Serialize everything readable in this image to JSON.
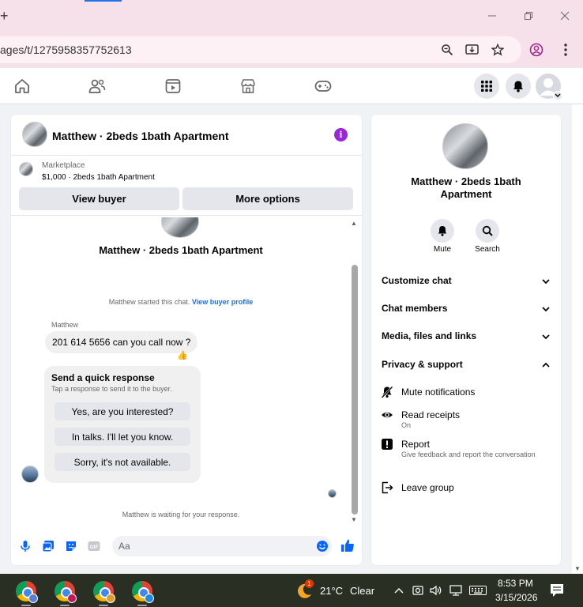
{
  "browser": {
    "url": "ages/t/1275958357752613",
    "new_tab_label": "+"
  },
  "header": {
    "title": "Matthew · 2beds 1bath Apartment"
  },
  "marketplace": {
    "label": "Marketplace",
    "price_line": "$1,000 · 2beds 1bath Apartment",
    "view_buyer": "View buyer",
    "more_options": "More options"
  },
  "conversation": {
    "title": "Matthew · 2beds 1bath Apartment",
    "started_text": "Matthew started this chat.",
    "view_profile": "View buyer profile",
    "sender": "Matthew",
    "message": "201 614 5656 can you call now ?",
    "reaction": "👍",
    "quick_title": "Send a quick response",
    "quick_subtitle": "Tap a response to send it to the buyer.",
    "quick_options": [
      "Yes, are you interested?",
      "In talks. I'll let you know.",
      "Sorry, it's not available."
    ],
    "waiting": "Matthew is waiting for your response."
  },
  "composer": {
    "placeholder": "Aa"
  },
  "info": {
    "title": "Matthew · 2beds 1bath Apartment",
    "mute": "Mute",
    "search": "Search",
    "sections": [
      "Customize chat",
      "Chat members",
      "Media, files and links",
      "Privacy & support"
    ],
    "privacy_items": [
      {
        "title": "Mute notifications",
        "sub": ""
      },
      {
        "title": "Read receipts",
        "sub": "On"
      },
      {
        "title": "Report",
        "sub": "Give feedback and report the conversation"
      },
      {
        "title": "Leave group",
        "sub": ""
      }
    ]
  },
  "taskbar": {
    "weather_temp": "21°C",
    "weather_text": "Clear",
    "time": "8:53 PM",
    "date": "3/15/2026",
    "weather_badge": "1"
  },
  "colors": {
    "fb_blue": "#216fdb",
    "info_purple": "#9b25d8",
    "chrome_pink": "#f6e1ea"
  }
}
